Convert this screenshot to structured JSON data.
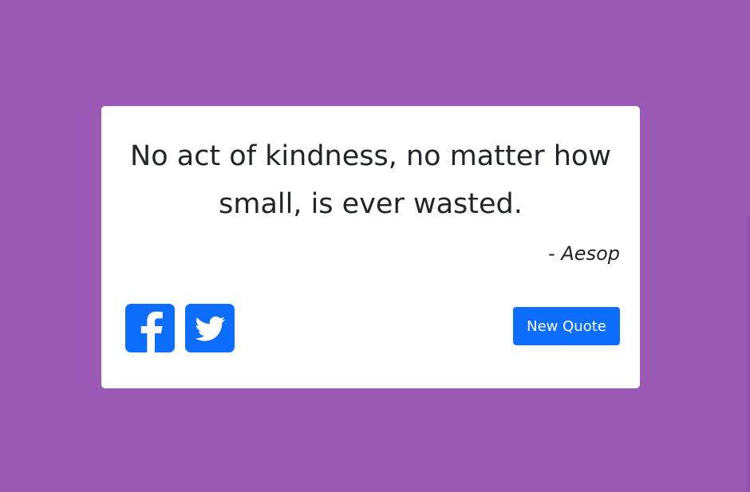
{
  "colors": {
    "background": "#9b59b6",
    "card": "#ffffff",
    "text": "#212529",
    "accent": "#0d6efd"
  },
  "quote": {
    "text": "No act of kindness, no matter how small, is ever wasted.",
    "dash": "- ",
    "author": "Aesop"
  },
  "share": {
    "facebook_icon": "facebook-square-icon",
    "twitter_icon": "twitter-square-icon"
  },
  "actions": {
    "new_quote_label": "New Quote"
  }
}
